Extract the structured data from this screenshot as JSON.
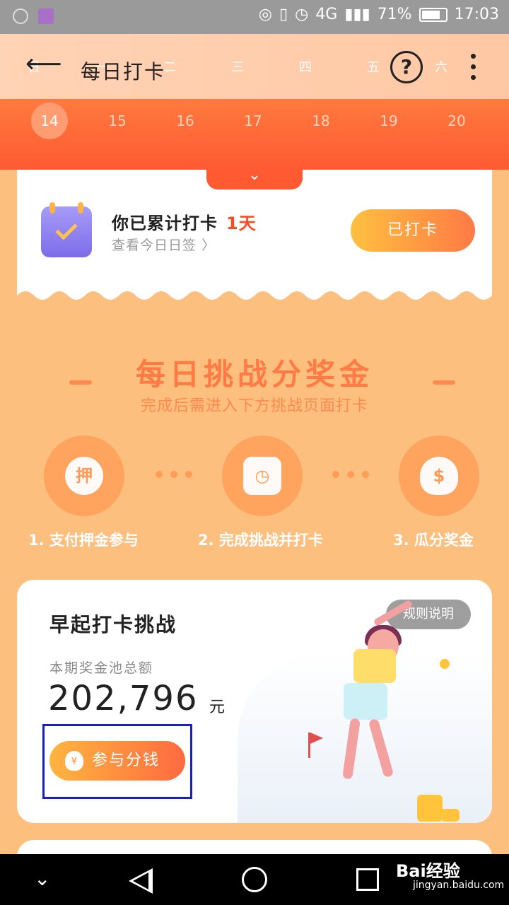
{
  "status_bar": {
    "icons_left": [
      "sensor-icon",
      "image-icon"
    ],
    "signal_text": "4G",
    "battery_percent": "71%",
    "time": "17:03"
  },
  "header": {
    "title": "每日打卡",
    "weekdays": [
      "日",
      "一",
      "二",
      "三",
      "四",
      "五",
      "六"
    ],
    "dates": [
      "14",
      "15",
      "16",
      "17",
      "18",
      "19",
      "20"
    ],
    "current_date": "14"
  },
  "checkin_card": {
    "streak_text": "你已累计打卡",
    "streak_days": "1天",
    "see_today": "查看今日日签",
    "checked_button": "已打卡"
  },
  "challenge_intro": {
    "title": "每日挑战分奖金",
    "subtitle": "完成后需进入下方挑战页面打卡",
    "steps": [
      {
        "label": "1. 支付押金参与",
        "icon_text": "押"
      },
      {
        "label": "2. 完成挑战并打卡",
        "icon_text": ""
      },
      {
        "label": "3. 瓜分奖金",
        "icon_text": "$"
      }
    ]
  },
  "challenge_card": {
    "title": "早起打卡挑战",
    "rules_button": "规则说明",
    "pool_label": "本期奖金池总额",
    "pool_amount": "202,796",
    "pool_unit": "元",
    "join_button": "参与分钱",
    "join_icon_text": "¥"
  },
  "watermark": {
    "brand": "Bai经验",
    "url": "jingyan.baidu.com"
  },
  "colors": {
    "accent": "#FF5A32",
    "page_bg": "#FDBF7E",
    "highlight_box": "#1520C8"
  }
}
